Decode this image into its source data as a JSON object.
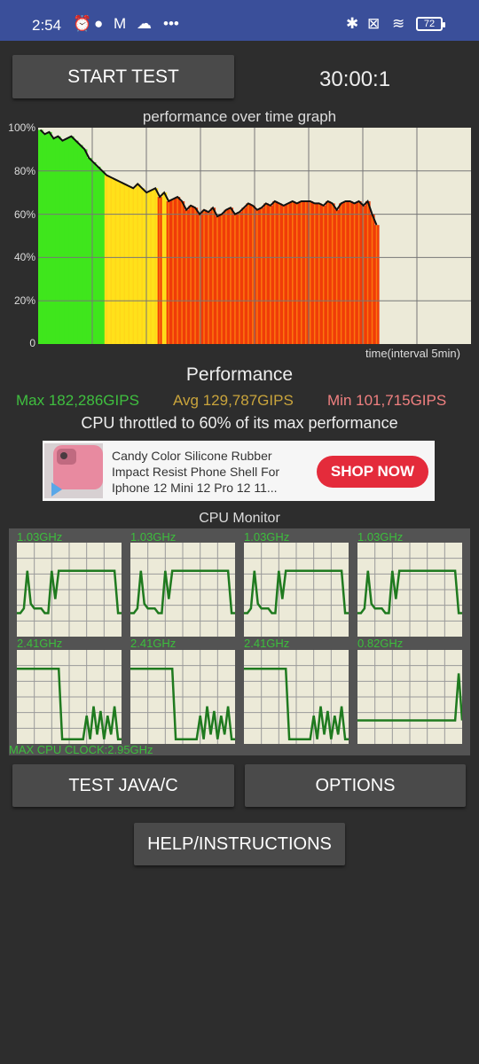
{
  "status_bar": {
    "time": "2:54",
    "left_icons": [
      "alarm-off-icon",
      "chat-bubble-icon",
      "gmail-icon",
      "cloud-icon",
      "more-dots-icon"
    ],
    "right_icons": [
      "bluetooth-icon",
      "no-sim-icon",
      "wifi-icon"
    ],
    "battery": "72"
  },
  "controls": {
    "start_test": "START TEST",
    "timer": "30:00:1"
  },
  "graph": {
    "title": "performance over time graph",
    "y_labels": [
      "100%",
      "80%",
      "60%",
      "40%",
      "20%",
      "0"
    ],
    "x_label": "time(interval 5min)"
  },
  "chart_data": {
    "type": "area",
    "title": "performance over time graph",
    "xlabel": "time(interval 5min)",
    "ylabel": "",
    "ylim": [
      0,
      100
    ],
    "grid": true,
    "x_tick_count": 8,
    "series": [
      {
        "values": [
          99,
          97,
          98,
          95,
          96,
          94,
          95,
          96,
          94,
          92,
          90,
          86,
          84,
          82,
          80,
          78,
          77,
          76,
          75,
          74,
          73,
          72,
          74,
          72,
          70,
          71,
          72,
          68,
          70,
          66,
          67,
          68,
          66,
          62,
          64,
          63,
          60,
          62,
          61,
          63,
          59,
          60,
          62,
          63,
          60,
          61,
          63,
          65,
          64,
          62,
          63,
          65,
          64,
          66,
          65,
          64,
          65,
          66,
          65,
          66,
          66,
          66,
          65,
          65,
          64,
          66,
          65,
          62,
          65,
          66,
          66,
          65,
          66,
          64,
          66,
          60,
          55
        ]
      }
    ],
    "colors": {
      "high": "#3fe61c",
      "mid": "#ffe11a",
      "low": "#f03c08"
    }
  },
  "performance": {
    "title": "Performance",
    "max": "Max 182,286GIPS",
    "avg": "Avg 129,787GIPS",
    "min": "Min 101,715GIPS",
    "throttle_text": "CPU throttled to 60% of its max performance",
    "colors": {
      "max": "#3fbf3f",
      "avg": "#c9a43c",
      "min": "#f08080"
    }
  },
  "ad": {
    "text": "Candy Color Silicone Rubber Impact Resist Phone Shell For Iphone 12 Mini 12 Pro 12 11...",
    "cta": "SHOP NOW"
  },
  "cpu_monitor": {
    "title": "CPU Monitor",
    "max_clock": "MAX CPU CLOCK:2.95GHz",
    "cores": [
      {
        "freq": "1.03GHz",
        "levels": [
          0.25,
          0.25,
          0.3,
          0.7,
          0.35,
          0.3,
          0.3,
          0.3,
          0.25,
          0.25,
          0.7,
          0.4,
          0.7,
          0.7,
          0.7,
          0.7,
          0.7,
          0.7,
          0.7,
          0.7,
          0.7,
          0.7,
          0.7,
          0.7,
          0.7,
          0.7,
          0.7,
          0.7,
          0.7,
          0.25,
          0.25
        ]
      },
      {
        "freq": "1.03GHz",
        "levels": [
          0.25,
          0.25,
          0.3,
          0.7,
          0.35,
          0.3,
          0.3,
          0.3,
          0.25,
          0.25,
          0.7,
          0.4,
          0.7,
          0.7,
          0.7,
          0.7,
          0.7,
          0.7,
          0.7,
          0.7,
          0.7,
          0.7,
          0.7,
          0.7,
          0.7,
          0.7,
          0.7,
          0.7,
          0.7,
          0.25,
          0.25
        ]
      },
      {
        "freq": "1.03GHz",
        "levels": [
          0.25,
          0.25,
          0.3,
          0.7,
          0.35,
          0.3,
          0.3,
          0.3,
          0.25,
          0.25,
          0.7,
          0.4,
          0.7,
          0.7,
          0.7,
          0.7,
          0.7,
          0.7,
          0.7,
          0.7,
          0.7,
          0.7,
          0.7,
          0.7,
          0.7,
          0.7,
          0.7,
          0.7,
          0.7,
          0.25,
          0.25
        ]
      },
      {
        "freq": "1.03GHz",
        "levels": [
          0.25,
          0.25,
          0.3,
          0.7,
          0.35,
          0.3,
          0.3,
          0.3,
          0.25,
          0.25,
          0.7,
          0.4,
          0.7,
          0.7,
          0.7,
          0.7,
          0.7,
          0.7,
          0.7,
          0.7,
          0.7,
          0.7,
          0.7,
          0.7,
          0.7,
          0.7,
          0.7,
          0.7,
          0.7,
          0.25,
          0.25
        ]
      },
      {
        "freq": "2.41GHz",
        "levels": [
          0.8,
          0.8,
          0.8,
          0.8,
          0.8,
          0.8,
          0.8,
          0.8,
          0.8,
          0.8,
          0.8,
          0.8,
          0.8,
          0.05,
          0.05,
          0.05,
          0.05,
          0.05,
          0.05,
          0.05,
          0.3,
          0.05,
          0.4,
          0.1,
          0.35,
          0.05,
          0.3,
          0.1,
          0.4,
          0.05,
          0.05
        ]
      },
      {
        "freq": "2.41GHz",
        "levels": [
          0.8,
          0.8,
          0.8,
          0.8,
          0.8,
          0.8,
          0.8,
          0.8,
          0.8,
          0.8,
          0.8,
          0.8,
          0.8,
          0.05,
          0.05,
          0.05,
          0.05,
          0.05,
          0.05,
          0.05,
          0.3,
          0.05,
          0.4,
          0.1,
          0.35,
          0.05,
          0.3,
          0.1,
          0.4,
          0.05,
          0.05
        ]
      },
      {
        "freq": "2.41GHz",
        "levels": [
          0.8,
          0.8,
          0.8,
          0.8,
          0.8,
          0.8,
          0.8,
          0.8,
          0.8,
          0.8,
          0.8,
          0.8,
          0.8,
          0.05,
          0.05,
          0.05,
          0.05,
          0.05,
          0.05,
          0.05,
          0.3,
          0.05,
          0.4,
          0.1,
          0.35,
          0.05,
          0.3,
          0.1,
          0.4,
          0.05,
          0.05
        ]
      },
      {
        "freq": "0.82GHz",
        "levels": [
          0.25,
          0.25,
          0.25,
          0.25,
          0.25,
          0.25,
          0.25,
          0.25,
          0.25,
          0.25,
          0.25,
          0.25,
          0.25,
          0.25,
          0.25,
          0.25,
          0.25,
          0.25,
          0.25,
          0.25,
          0.25,
          0.25,
          0.25,
          0.25,
          0.25,
          0.25,
          0.25,
          0.25,
          0.25,
          0.75,
          0.25
        ]
      }
    ]
  },
  "buttons": {
    "test_java": "TEST JAVA/C",
    "options": "OPTIONS",
    "help": "HELP/INSTRUCTIONS"
  }
}
